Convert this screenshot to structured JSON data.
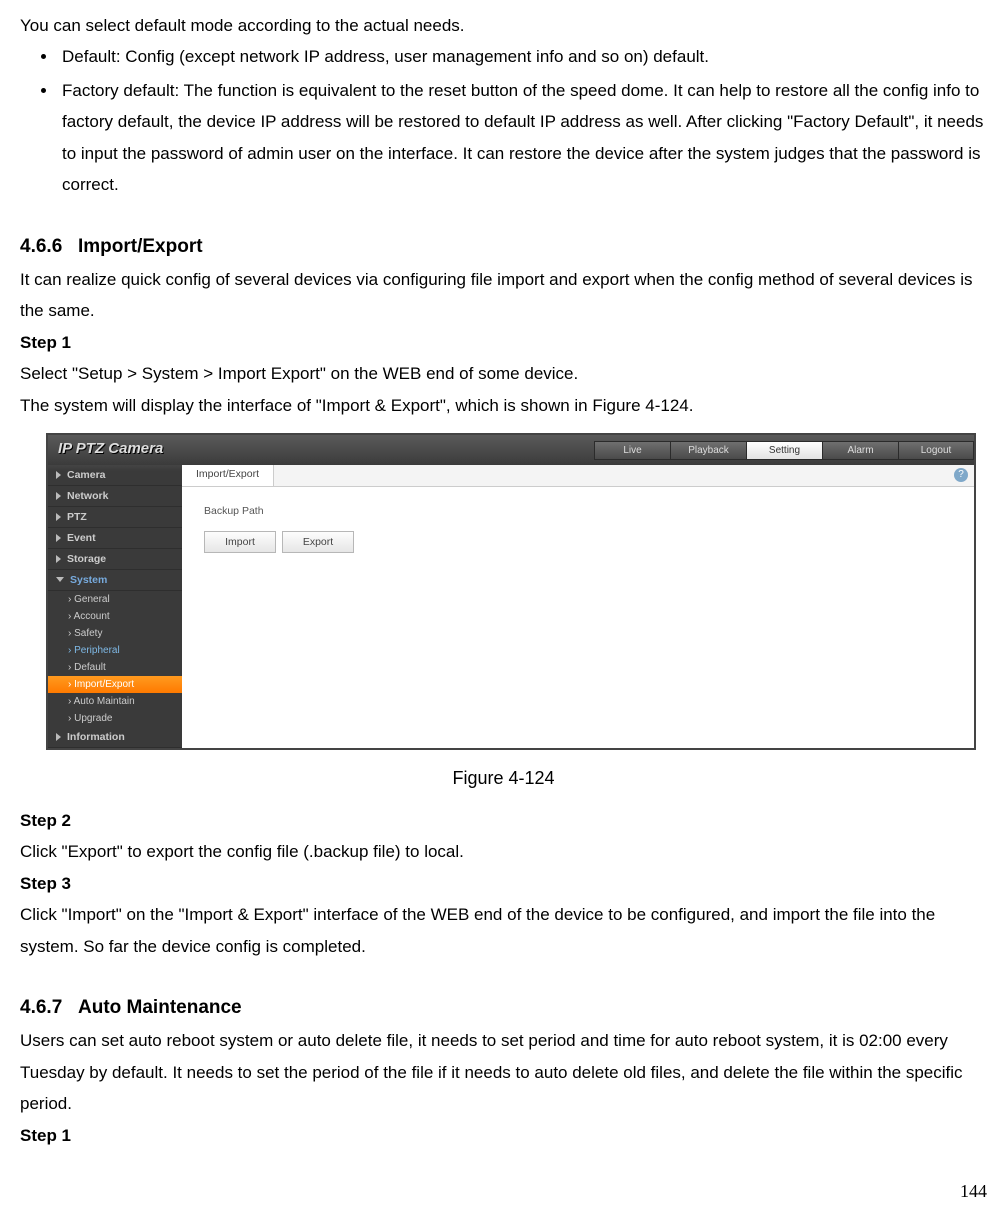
{
  "intro": "You can select default mode according to the actual needs.",
  "bullets": [
    "Default: Config (except network IP address, user management info and so on) default.",
    "Factory default: The function is equivalent to the reset button of the speed dome. It can help to restore all the config info to factory default, the device IP address will be restored to default IP address as well. After clicking \"Factory Default\", it needs to input the password of admin user on the interface. It can restore the device after the system judges that the password is correct."
  ],
  "section466": {
    "num": "4.6.6",
    "title": "Import/Export"
  },
  "p466a": "It can realize quick config of several devices via configuring file import and export when the config method of several devices is the same.",
  "step1": "Step 1",
  "p466b": "Select \"Setup > System > Import Export\" on the WEB end of some device.",
  "p466c": "The system will display the interface of \"Import & Export\", which is shown in Figure 4-124.",
  "figure_caption": "Figure 4-124",
  "step2": "Step 2",
  "p_step2": "Click \"Export\" to export the config file (.backup file) to local.",
  "step3": "Step 3",
  "p_step3": "Click \"Import\" on the \"Import & Export\" interface of the WEB end of the device to be configured, and import the file into the system. So far the device config is completed.",
  "section467": {
    "num": "4.6.7",
    "title": "Auto Maintenance"
  },
  "p467": "Users can set auto reboot system or auto delete file, it needs to set period and time for auto reboot system, it is 02:00 every Tuesday by default. It needs to set the period of the file if it needs to auto delete old files, and delete the file within the specific period.",
  "step1b": "Step 1",
  "page_num": "144",
  "ui": {
    "brand": "IP PTZ Camera",
    "topnav": [
      "Live",
      "Playback",
      "Setting",
      "Alarm",
      "Logout"
    ],
    "topnav_active": "Setting",
    "sidebar": [
      {
        "label": "Camera",
        "open": false
      },
      {
        "label": "Network",
        "open": false
      },
      {
        "label": "PTZ",
        "open": false
      },
      {
        "label": "Event",
        "open": false
      },
      {
        "label": "Storage",
        "open": false
      },
      {
        "label": "System",
        "open": true,
        "syscolor": true,
        "children": [
          {
            "label": "General"
          },
          {
            "label": "Account"
          },
          {
            "label": "Safety"
          },
          {
            "label": "Peripheral",
            "peri": true
          },
          {
            "label": "Default"
          },
          {
            "label": "Import/Export",
            "active": true
          },
          {
            "label": "Auto Maintain"
          },
          {
            "label": "Upgrade"
          }
        ]
      },
      {
        "label": "Information",
        "open": false
      }
    ],
    "tab": "Import/Export",
    "help": "?",
    "backup_label": "Backup Path",
    "btn_import": "Import",
    "btn_export": "Export"
  }
}
